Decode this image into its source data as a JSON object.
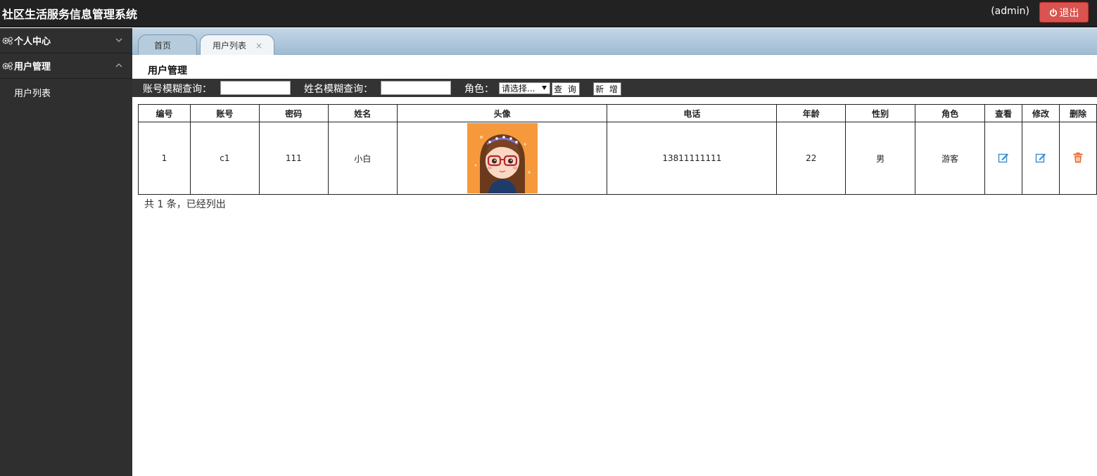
{
  "header": {
    "title": "社区生活服务信息管理系统",
    "user": "(admin)",
    "logout_label": "退出"
  },
  "sidebar": {
    "groups": [
      {
        "label": "个人中心",
        "expanded": false,
        "items": []
      },
      {
        "label": "用户管理",
        "expanded": true,
        "items": [
          {
            "label": "用户列表"
          }
        ]
      }
    ]
  },
  "tabs": [
    {
      "label": "首页",
      "active": false
    },
    {
      "label": "用户列表",
      "active": true,
      "closable": true,
      "close": "×"
    }
  ],
  "section_title": "用户管理",
  "search": {
    "account_label": "账号模糊查询：",
    "account_value": "",
    "name_label": "姓名模糊查询：",
    "name_value": "",
    "role_label": "角色：",
    "role_selected": "请选择...",
    "query_label": "查 询",
    "add_label": "新 增"
  },
  "table": {
    "columns": [
      "编号",
      "账号",
      "密码",
      "姓名",
      "头像",
      "电话",
      "年龄",
      "性别",
      "角色",
      "查看",
      "修改",
      "删除"
    ],
    "rows": [
      {
        "id": "1",
        "account": "c1",
        "password": "111",
        "name": "小白",
        "avatar": "cartoon-girl-avatar",
        "phone": "13811111111",
        "age": "22",
        "gender": "男",
        "role": "游客",
        "view_icon": "edit-icon",
        "edit_icon": "edit-icon",
        "delete_icon": "trash-icon"
      }
    ]
  },
  "footer": {
    "count_text": "共 1 条，已经列出"
  },
  "colors": {
    "header_bg": "#222222",
    "sidebar_bg": "#2f2f2f",
    "toolbar_bg": "#333333",
    "logout_red": "#d9534f",
    "icon_blue": "#3a8ccc",
    "icon_orange": "#e8743b"
  }
}
